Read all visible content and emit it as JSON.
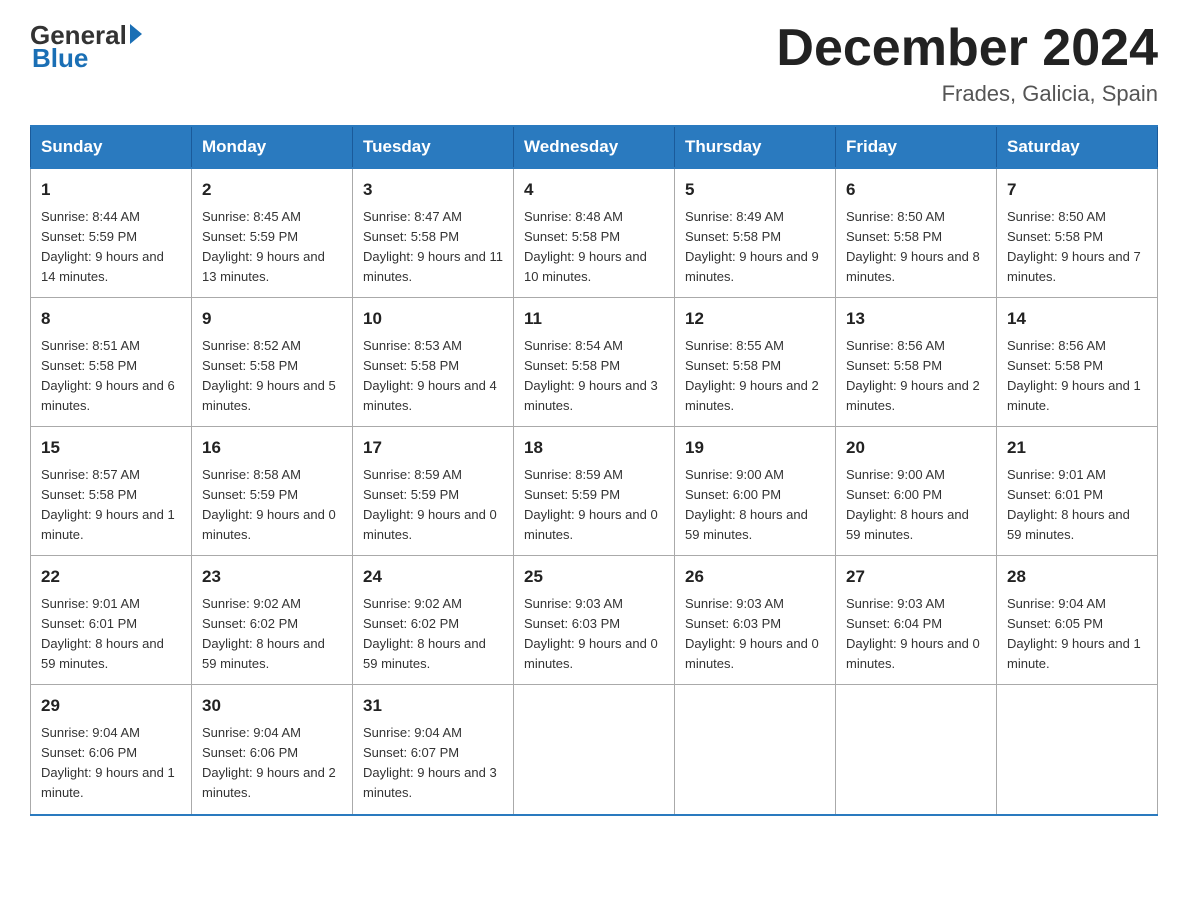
{
  "header": {
    "logo_general": "General",
    "logo_blue": "Blue",
    "month_title": "December 2024",
    "location": "Frades, Galicia, Spain"
  },
  "days_of_week": [
    "Sunday",
    "Monday",
    "Tuesday",
    "Wednesday",
    "Thursday",
    "Friday",
    "Saturday"
  ],
  "weeks": [
    [
      {
        "day": "1",
        "sunrise": "8:44 AM",
        "sunset": "5:59 PM",
        "daylight": "9 hours and 14 minutes."
      },
      {
        "day": "2",
        "sunrise": "8:45 AM",
        "sunset": "5:59 PM",
        "daylight": "9 hours and 13 minutes."
      },
      {
        "day": "3",
        "sunrise": "8:47 AM",
        "sunset": "5:58 PM",
        "daylight": "9 hours and 11 minutes."
      },
      {
        "day": "4",
        "sunrise": "8:48 AM",
        "sunset": "5:58 PM",
        "daylight": "9 hours and 10 minutes."
      },
      {
        "day": "5",
        "sunrise": "8:49 AM",
        "sunset": "5:58 PM",
        "daylight": "9 hours and 9 minutes."
      },
      {
        "day": "6",
        "sunrise": "8:50 AM",
        "sunset": "5:58 PM",
        "daylight": "9 hours and 8 minutes."
      },
      {
        "day": "7",
        "sunrise": "8:50 AM",
        "sunset": "5:58 PM",
        "daylight": "9 hours and 7 minutes."
      }
    ],
    [
      {
        "day": "8",
        "sunrise": "8:51 AM",
        "sunset": "5:58 PM",
        "daylight": "9 hours and 6 minutes."
      },
      {
        "day": "9",
        "sunrise": "8:52 AM",
        "sunset": "5:58 PM",
        "daylight": "9 hours and 5 minutes."
      },
      {
        "day": "10",
        "sunrise": "8:53 AM",
        "sunset": "5:58 PM",
        "daylight": "9 hours and 4 minutes."
      },
      {
        "day": "11",
        "sunrise": "8:54 AM",
        "sunset": "5:58 PM",
        "daylight": "9 hours and 3 minutes."
      },
      {
        "day": "12",
        "sunrise": "8:55 AM",
        "sunset": "5:58 PM",
        "daylight": "9 hours and 2 minutes."
      },
      {
        "day": "13",
        "sunrise": "8:56 AM",
        "sunset": "5:58 PM",
        "daylight": "9 hours and 2 minutes."
      },
      {
        "day": "14",
        "sunrise": "8:56 AM",
        "sunset": "5:58 PM",
        "daylight": "9 hours and 1 minute."
      }
    ],
    [
      {
        "day": "15",
        "sunrise": "8:57 AM",
        "sunset": "5:58 PM",
        "daylight": "9 hours and 1 minute."
      },
      {
        "day": "16",
        "sunrise": "8:58 AM",
        "sunset": "5:59 PM",
        "daylight": "9 hours and 0 minutes."
      },
      {
        "day": "17",
        "sunrise": "8:59 AM",
        "sunset": "5:59 PM",
        "daylight": "9 hours and 0 minutes."
      },
      {
        "day": "18",
        "sunrise": "8:59 AM",
        "sunset": "5:59 PM",
        "daylight": "9 hours and 0 minutes."
      },
      {
        "day": "19",
        "sunrise": "9:00 AM",
        "sunset": "6:00 PM",
        "daylight": "8 hours and 59 minutes."
      },
      {
        "day": "20",
        "sunrise": "9:00 AM",
        "sunset": "6:00 PM",
        "daylight": "8 hours and 59 minutes."
      },
      {
        "day": "21",
        "sunrise": "9:01 AM",
        "sunset": "6:01 PM",
        "daylight": "8 hours and 59 minutes."
      }
    ],
    [
      {
        "day": "22",
        "sunrise": "9:01 AM",
        "sunset": "6:01 PM",
        "daylight": "8 hours and 59 minutes."
      },
      {
        "day": "23",
        "sunrise": "9:02 AM",
        "sunset": "6:02 PM",
        "daylight": "8 hours and 59 minutes."
      },
      {
        "day": "24",
        "sunrise": "9:02 AM",
        "sunset": "6:02 PM",
        "daylight": "8 hours and 59 minutes."
      },
      {
        "day": "25",
        "sunrise": "9:03 AM",
        "sunset": "6:03 PM",
        "daylight": "9 hours and 0 minutes."
      },
      {
        "day": "26",
        "sunrise": "9:03 AM",
        "sunset": "6:03 PM",
        "daylight": "9 hours and 0 minutes."
      },
      {
        "day": "27",
        "sunrise": "9:03 AM",
        "sunset": "6:04 PM",
        "daylight": "9 hours and 0 minutes."
      },
      {
        "day": "28",
        "sunrise": "9:04 AM",
        "sunset": "6:05 PM",
        "daylight": "9 hours and 1 minute."
      }
    ],
    [
      {
        "day": "29",
        "sunrise": "9:04 AM",
        "sunset": "6:06 PM",
        "daylight": "9 hours and 1 minute."
      },
      {
        "day": "30",
        "sunrise": "9:04 AM",
        "sunset": "6:06 PM",
        "daylight": "9 hours and 2 minutes."
      },
      {
        "day": "31",
        "sunrise": "9:04 AM",
        "sunset": "6:07 PM",
        "daylight": "9 hours and 3 minutes."
      },
      null,
      null,
      null,
      null
    ]
  ],
  "labels": {
    "sunrise": "Sunrise:",
    "sunset": "Sunset:",
    "daylight": "Daylight:"
  }
}
